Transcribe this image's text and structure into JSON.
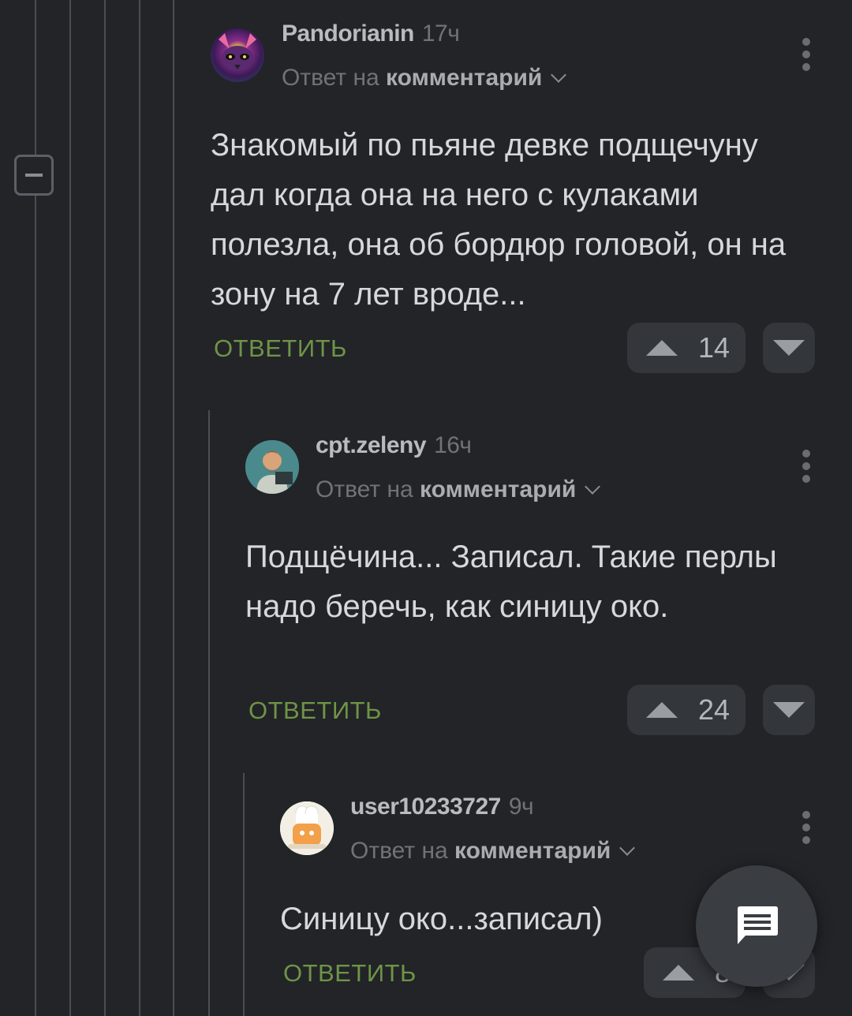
{
  "comments": [
    {
      "username": "Pandorianin",
      "time": "17ч",
      "reply_prefix": "Ответ на",
      "reply_target": "комментарий",
      "body": "Знакомый по пьяне девке подщечуну дал когда она на него с кулаками полезла, она об бордюр головой, он на зону на 7 лет вроде...",
      "reply_label": "ОТВЕТИТЬ",
      "votes": "14"
    },
    {
      "username": "cpt.zeleny",
      "time": "16ч",
      "reply_prefix": "Ответ на",
      "reply_target": "комментарий",
      "body": "Подщёчина... Записал. Такие перлы надо беречь, как синицу око.",
      "reply_label": "ОТВЕТИТЬ",
      "votes": "24"
    },
    {
      "username": "user10233727",
      "time": "9ч",
      "reply_prefix": "Ответ на",
      "reply_target": "комментарий",
      "body": "Синицу око...записал)",
      "reply_label": "ОТВЕТИТЬ",
      "votes": "8"
    }
  ],
  "icons": {
    "collapse": "minus-square-icon",
    "more": "more-vertical-icon",
    "upvote": "triangle-up-icon",
    "downvote": "triangle-down-icon",
    "chat": "chat-bubble-icon"
  },
  "colors": {
    "background": "#222428",
    "reply_link": "#6f9446",
    "text": "#d6d8db"
  }
}
